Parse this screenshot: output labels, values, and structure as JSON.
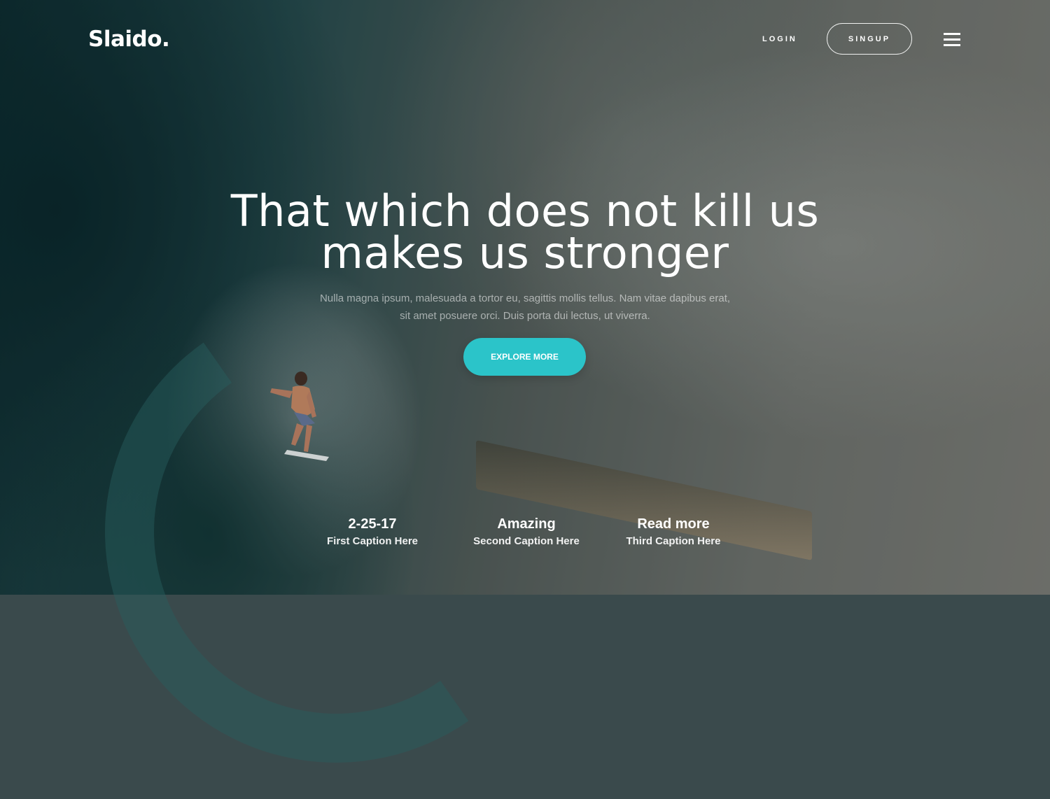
{
  "brand": {
    "logo": "Slaido."
  },
  "nav": {
    "login_label": "LOGIN",
    "signup_label": "SINGUP",
    "menu_icon": "hamburger-icon"
  },
  "hero": {
    "headline_line1": "That which does not kill us",
    "headline_line2": "makes us stronger",
    "subtext_line1": "Nulla magna ipsum, malesuada a tortor eu, sagittis mollis tellus. Nam vitae dapibus erat,",
    "subtext_line2": "sit amet posuere orci. Duis porta dui lectus, ut viverra.",
    "cta_label": "EXPLORE MORE",
    "accent_color": "#2bc4c9"
  },
  "captions": [
    {
      "title": "2-25-17",
      "subtitle": "First Caption Here"
    },
    {
      "title": "Amazing",
      "subtitle": "Second Caption Here"
    },
    {
      "title": "Read more",
      "subtitle": "Third Caption Here"
    }
  ]
}
